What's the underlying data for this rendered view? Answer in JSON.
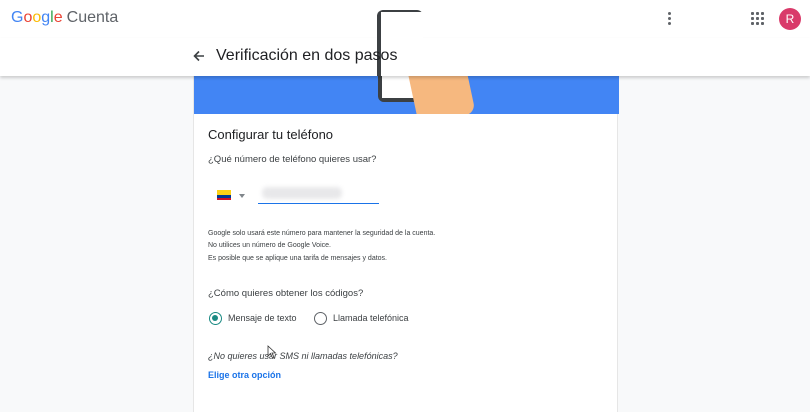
{
  "header": {
    "logo_google": "Google",
    "logo_product": "Cuenta",
    "avatar_initial": "R"
  },
  "page": {
    "title": "Verificación en dos pasos"
  },
  "setup": {
    "section_title": "Configurar tu teléfono",
    "phone_question": "¿Qué número de teléfono quieres usar?",
    "phone_value": "",
    "country_flag": "colombia-flag-icon",
    "notes": [
      "Google solo usará este número para mantener la seguridad de la cuenta.",
      "No utilices un número de Google Voice.",
      "Es posible que se aplique una tarifa de mensajes y datos."
    ],
    "codes_question": "¿Cómo quieres obtener los códigos?",
    "options": [
      {
        "label": "Mensaje de texto",
        "selected": true
      },
      {
        "label": "Llamada telefónica",
        "selected": false
      }
    ],
    "no_sms_text": "¿No quieres usar SMS ni llamadas telefónicas?",
    "other_option_link": "Elige otra opción"
  },
  "colors": {
    "accent_blue": "#1a73e8",
    "hero_blue": "#4285f4",
    "radio_teal": "#1a8a83",
    "avatar": "#d93a6a"
  }
}
